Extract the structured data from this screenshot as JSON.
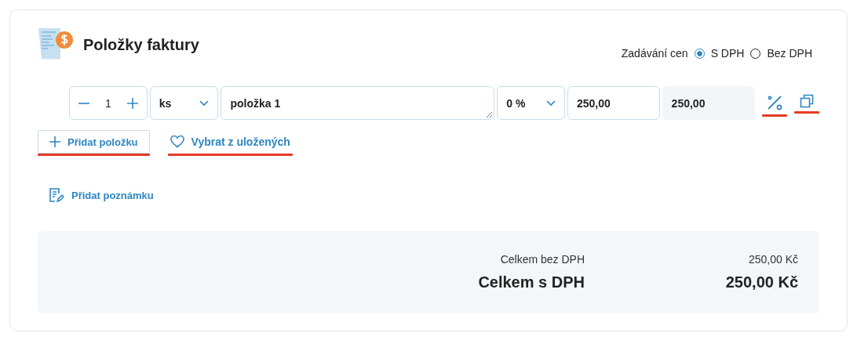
{
  "title": "Položky faktury",
  "price_entry": {
    "label": "Zadávání cen",
    "options": [
      {
        "label": "S DPH",
        "selected": true
      },
      {
        "label": "Bez DPH",
        "selected": false
      }
    ]
  },
  "items": [
    {
      "quantity": "1",
      "unit": "ks",
      "name": "položka 1",
      "vat": "0 %",
      "price": "250,00",
      "total": "250,00"
    }
  ],
  "actions": [
    {
      "kind": "add",
      "label": "Přidat položku"
    },
    {
      "kind": "saved",
      "label": "Vybrat z uložených"
    }
  ],
  "note_button": "Přidat poznámku",
  "summary": [
    {
      "kind": "net",
      "label": "Celkem bez DPH",
      "value": "250,00 Kč"
    },
    {
      "kind": "gross",
      "label": "Celkem s DPH",
      "value": "250,00 Kč"
    }
  ]
}
